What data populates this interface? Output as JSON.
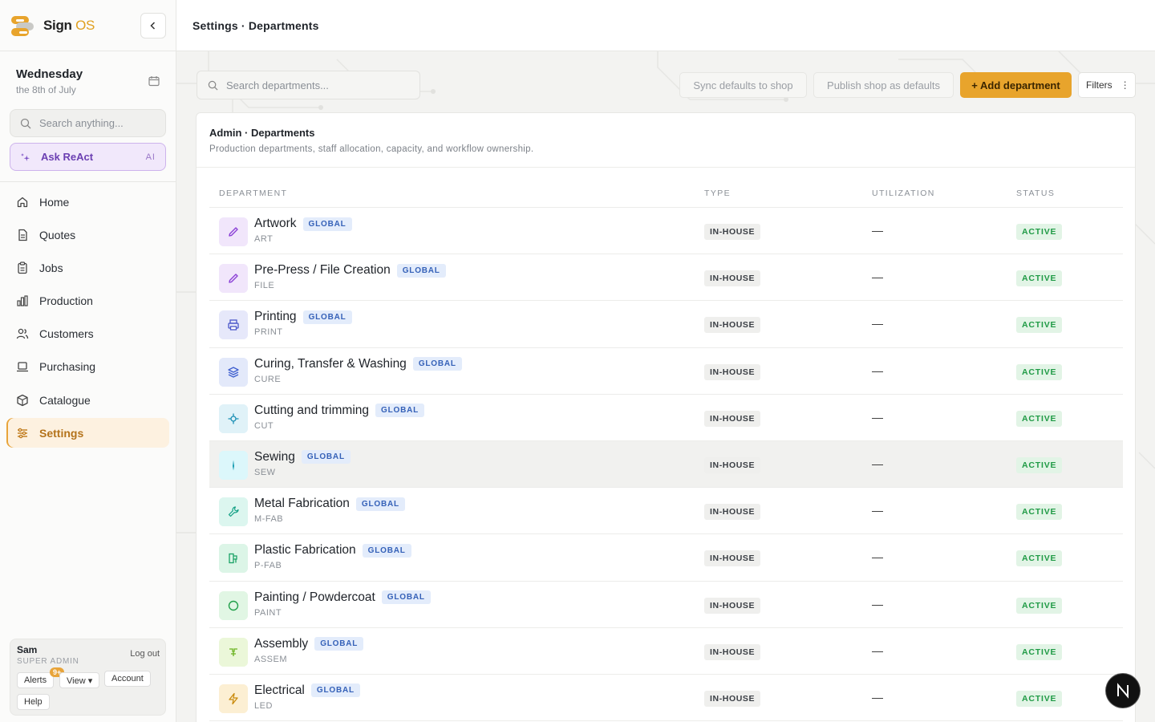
{
  "brand": {
    "name_main": "Sign",
    "name_accent": "OS"
  },
  "sidebar": {
    "date_day": "Wednesday",
    "date_sub": "the 8th of July",
    "search_placeholder": "Search anything...",
    "ask": {
      "label": "Ask ReAct",
      "badge": "AI"
    },
    "nav": [
      {
        "label": "Home",
        "icon": "home-icon"
      },
      {
        "label": "Quotes",
        "icon": "document-icon"
      },
      {
        "label": "Jobs",
        "icon": "clipboard-icon"
      },
      {
        "label": "Production",
        "icon": "bar-chart-icon"
      },
      {
        "label": "Customers",
        "icon": "users-icon"
      },
      {
        "label": "Purchasing",
        "icon": "laptop-icon"
      },
      {
        "label": "Catalogue",
        "icon": "box-icon"
      },
      {
        "label": "Settings",
        "icon": "sliders-icon",
        "active": true
      }
    ],
    "user": {
      "name": "Sam",
      "role": "SUPER ADMIN",
      "logout": "Log out",
      "alerts": "Alerts",
      "alerts_badge": "9+",
      "view": "View ▾",
      "account": "Account",
      "help": "Help"
    }
  },
  "header": {
    "title": "Settings · Departments"
  },
  "toolbar": {
    "search_placeholder": "Search departments...",
    "sync": "Sync defaults to shop",
    "publish": "Publish shop as defaults",
    "add": "+ Add department",
    "filters": "Filters"
  },
  "card": {
    "title": "Admin · Departments",
    "subtitle": "Production departments, staff allocation, capacity, and workflow ownership."
  },
  "table": {
    "columns": [
      "DEPARTMENT",
      "TYPE",
      "UTILIZATION",
      "STATUS"
    ],
    "rows": [
      {
        "name": "Artwork",
        "code": "ART",
        "tag": "GLOBAL",
        "type": "IN-HOUSE",
        "util": "—",
        "status": "ACTIVE",
        "icon": "pencil-icon",
        "color": "#8a3fd6",
        "bg": "#f1e6fb"
      },
      {
        "name": "Pre-Press / File Creation",
        "code": "FILE",
        "tag": "GLOBAL",
        "type": "IN-HOUSE",
        "util": "—",
        "status": "ACTIVE",
        "icon": "pencil-icon",
        "color": "#8a3fd6",
        "bg": "#f1e6fb"
      },
      {
        "name": "Printing",
        "code": "PRINT",
        "tag": "GLOBAL",
        "type": "IN-HOUSE",
        "util": "—",
        "status": "ACTIVE",
        "icon": "printer-icon",
        "color": "#4a56c9",
        "bg": "#e6e8fa"
      },
      {
        "name": "Curing, Transfer & Washing",
        "code": "CURE",
        "tag": "GLOBAL",
        "type": "IN-HOUSE",
        "util": "—",
        "status": "ACTIVE",
        "icon": "layers-icon",
        "color": "#3f5fcf",
        "bg": "#e3e9fa"
      },
      {
        "name": "Cutting and trimming",
        "code": "CUT",
        "tag": "GLOBAL",
        "type": "IN-HOUSE",
        "util": "—",
        "status": "ACTIVE",
        "icon": "crosshair-icon",
        "color": "#1b8fb4",
        "bg": "#e0f2f8"
      },
      {
        "name": "Sewing",
        "code": "SEW",
        "tag": "GLOBAL",
        "type": "IN-HOUSE",
        "util": "—",
        "status": "ACTIVE",
        "icon": "needle-icon",
        "color": "#139ab0",
        "bg": "#dcf7fb",
        "highlight": true
      },
      {
        "name": "Metal Fabrication",
        "code": "M-FAB",
        "tag": "GLOBAL",
        "type": "IN-HOUSE",
        "util": "—",
        "status": "ACTIVE",
        "icon": "wrench-icon",
        "color": "#14a085",
        "bg": "#dcf6ef"
      },
      {
        "name": "Plastic Fabrication",
        "code": "P-FAB",
        "tag": "GLOBAL",
        "type": "IN-HOUSE",
        "util": "—",
        "status": "ACTIVE",
        "icon": "bucket-icon",
        "color": "#1aa266",
        "bg": "#dcf5e7"
      },
      {
        "name": "Painting / Powdercoat",
        "code": "PAINT",
        "tag": "GLOBAL",
        "type": "IN-HOUSE",
        "util": "—",
        "status": "ACTIVE",
        "icon": "circle-icon",
        "color": "#22a04a",
        "bg": "#e1f6e4"
      },
      {
        "name": "Assembly",
        "code": "ASSEM",
        "tag": "GLOBAL",
        "type": "IN-HOUSE",
        "util": "—",
        "status": "ACTIVE",
        "icon": "assembly-icon",
        "color": "#6ab21f",
        "bg": "#ebf7d9"
      },
      {
        "name": "Electrical",
        "code": "LED",
        "tag": "GLOBAL",
        "type": "IN-HOUSE",
        "util": "—",
        "status": "ACTIVE",
        "icon": "bolt-icon",
        "color": "#c98a0c",
        "bg": "#fcefd3"
      }
    ]
  },
  "fab": {
    "label": "N"
  },
  "colors": {
    "accent": "#e8a42c",
    "active_green": "#1f9a45",
    "global_blue": "#3561b8"
  }
}
